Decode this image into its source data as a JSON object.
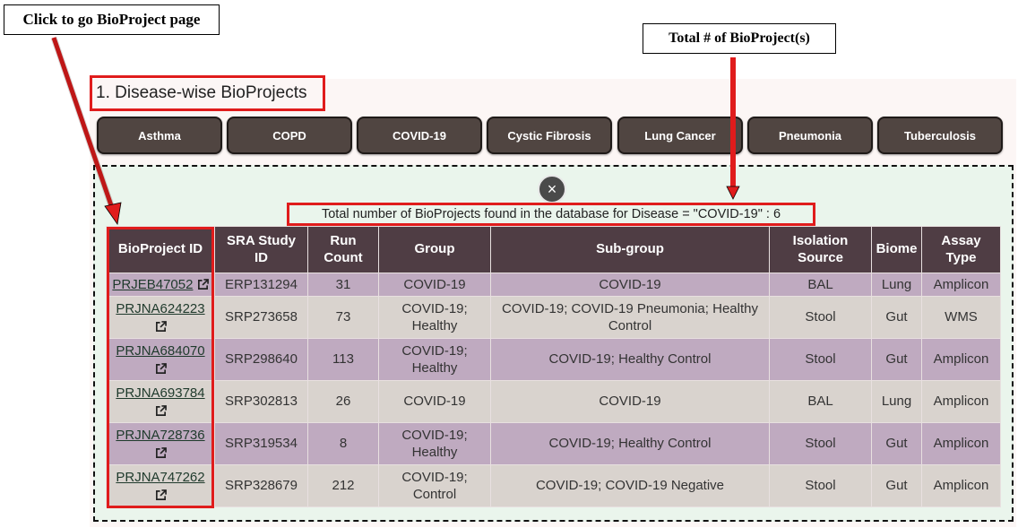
{
  "annotations": {
    "left_callout": "Click to go BioProject page",
    "right_callout": "Total # of BioProject(s)"
  },
  "section_title": "1. Disease-wise BioProjects",
  "disease_buttons": [
    "Asthma",
    "COPD",
    "COVID-19",
    "Cystic Fibrosis",
    "Lung Cancer",
    "Pneumonia",
    "Tuberculosis"
  ],
  "close_symbol": "×",
  "total_text": "Total number of BioProjects found in the database for Disease = \"COVID-19\" : 6",
  "table": {
    "headers": [
      "BioProject ID",
      "SRA Study ID",
      "Run Count",
      "Group",
      "Sub-group",
      "Isolation Source",
      "Biome",
      "Assay Type"
    ],
    "rows": [
      {
        "bioproject": "PRJEB47052",
        "sra": "ERP131294",
        "runs": "31",
        "group": "COVID-19",
        "subgroup": "COVID-19",
        "source": "BAL",
        "biome": "Lung",
        "assay": "Amplicon"
      },
      {
        "bioproject": "PRJNA624223",
        "sra": "SRP273658",
        "runs": "73",
        "group": "COVID-19; Healthy",
        "subgroup": "COVID-19; COVID-19 Pneumonia; Healthy Control",
        "source": "Stool",
        "biome": "Gut",
        "assay": "WMS"
      },
      {
        "bioproject": "PRJNA684070",
        "sra": "SRP298640",
        "runs": "113",
        "group": "COVID-19; Healthy",
        "subgroup": "COVID-19; Healthy Control",
        "source": "Stool",
        "biome": "Gut",
        "assay": "Amplicon"
      },
      {
        "bioproject": "PRJNA693784",
        "sra": "SRP302813",
        "runs": "26",
        "group": "COVID-19",
        "subgroup": "COVID-19",
        "source": "BAL",
        "biome": "Lung",
        "assay": "Amplicon"
      },
      {
        "bioproject": "PRJNA728736",
        "sra": "SRP319534",
        "runs": "8",
        "group": "COVID-19; Healthy",
        "subgroup": "COVID-19; Healthy Control",
        "source": "Stool",
        "biome": "Gut",
        "assay": "Amplicon"
      },
      {
        "bioproject": "PRJNA747262",
        "sra": "SRP328679",
        "runs": "212",
        "group": "COVID-19; Control",
        "subgroup": "COVID-19; COVID-19 Negative",
        "source": "Stool",
        "biome": "Gut",
        "assay": "Amplicon"
      }
    ]
  },
  "colors": {
    "header_bg": "#4f3d44",
    "row_alt_a": "#bfaac0",
    "row_alt_b": "#d9d3ce",
    "button_bg": "#504541",
    "highlight_red": "#e01c1c",
    "result_bg": "#eaf5ec"
  }
}
